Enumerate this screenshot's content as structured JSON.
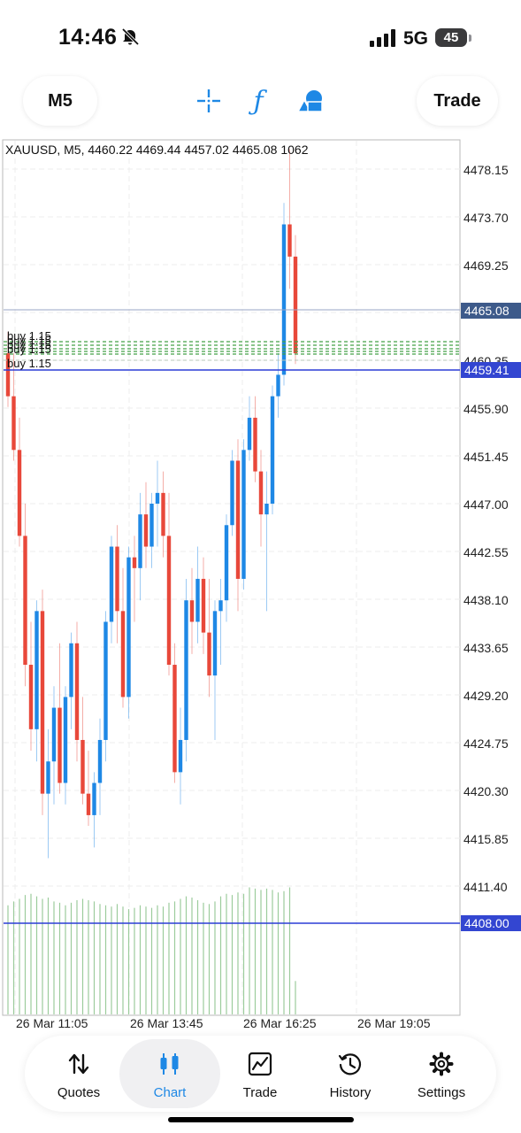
{
  "status_bar": {
    "time": "14:46",
    "network": "5G",
    "battery": "45"
  },
  "toolbar": {
    "timeframe": "M5",
    "trade_label": "Trade"
  },
  "chart": {
    "info": "XAUUSD, M5, 4460.22 4469.44 4457.02 4465.08 1062",
    "price_ticks": [
      "4478.15",
      "4473.70",
      "4469.25",
      "4460.35",
      "4455.90",
      "4451.45",
      "4447.00",
      "4442.55",
      "4438.10",
      "4433.65",
      "4429.20",
      "4424.75",
      "4420.30",
      "4415.85",
      "4411.40"
    ],
    "current_price": "4465.08",
    "order_line_price": "4459.41",
    "volume_line_price": "4408.00",
    "order_labels": [
      "buy 1.15",
      "buy 1.15",
      "buy 1.15",
      "buy 1.15",
      "buy 1.15"
    ],
    "time_labels": [
      "26 Mar 11:05",
      "26 Mar 13:45",
      "26 Mar 16:25",
      "26 Mar 19:05"
    ],
    "colors": {
      "bull": "#1e88e5",
      "bear": "#e8483a",
      "volume": "#9ccc9c",
      "order": "#43a047",
      "price_line": "#4a5fbd",
      "bid_line": "#2b3dd6"
    },
    "candles": [
      [
        4461,
        4463,
        4456,
        4457
      ],
      [
        4457,
        4461,
        4451,
        4452
      ],
      [
        4452,
        4455,
        4443,
        4444
      ],
      [
        4444,
        4447,
        4430,
        4432
      ],
      [
        4432,
        4436,
        4424,
        4426
      ],
      [
        4426,
        4438,
        4423,
        4437
      ],
      [
        4437,
        4439,
        4418,
        4420
      ],
      [
        4420,
        4426,
        4414,
        4423
      ],
      [
        4423,
        4430,
        4419,
        4428
      ],
      [
        4428,
        4434,
        4420,
        4421
      ],
      [
        4421,
        4430,
        4419,
        4429
      ],
      [
        4429,
        4435,
        4426,
        4434
      ],
      [
        4434,
        4436,
        4423,
        4425
      ],
      [
        4425,
        4429,
        4419,
        4420
      ],
      [
        4420,
        4424,
        4417,
        4418
      ],
      [
        4418,
        4422,
        4415,
        4421
      ],
      [
        4421,
        4427,
        4418,
        4425
      ],
      [
        4425,
        4437,
        4423,
        4436
      ],
      [
        4436,
        4444,
        4434,
        4443
      ],
      [
        4443,
        4445,
        4434,
        4437
      ],
      [
        4437,
        4441,
        4428,
        4429
      ],
      [
        4429,
        4443,
        4427,
        4442
      ],
      [
        4442,
        4444,
        4436,
        4441
      ],
      [
        4441,
        4448,
        4438,
        4446
      ],
      [
        4446,
        4449,
        4441,
        4443
      ],
      [
        4443,
        4448,
        4441,
        4447
      ],
      [
        4447,
        4451,
        4443,
        4448
      ],
      [
        4448,
        4450,
        4442,
        4444
      ],
      [
        4444,
        4448,
        4431,
        4432
      ],
      [
        4432,
        4434,
        4421,
        4422
      ],
      [
        4422,
        4428,
        4419,
        4425
      ],
      [
        4425,
        4440,
        4423,
        4438
      ],
      [
        4438,
        4441,
        4433,
        4436
      ],
      [
        4436,
        4443,
        4434,
        4440
      ],
      [
        4440,
        4442,
        4433,
        4435
      ],
      [
        4435,
        4440,
        4429,
        4431
      ],
      [
        4431,
        4438,
        4425,
        4437
      ],
      [
        4437,
        4440,
        4432,
        4438
      ],
      [
        4438,
        4446,
        4436,
        4445
      ],
      [
        4445,
        4452,
        4444,
        4451
      ],
      [
        4451,
        4453,
        4437,
        4440
      ],
      [
        4440,
        4453,
        4439,
        4452
      ],
      [
        4452,
        4457,
        4451,
        4455
      ],
      [
        4455,
        4457,
        4449,
        4450
      ],
      [
        4450,
        4452,
        4443,
        4446
      ],
      [
        4446,
        4450,
        4437,
        4447
      ],
      [
        4447,
        4458,
        4446,
        4457
      ],
      [
        4457,
        4461,
        4455,
        4459
      ],
      [
        4459,
        4475,
        4458,
        4473
      ],
      [
        4473,
        4480,
        4467,
        4470
      ],
      [
        4470,
        4472,
        4460,
        4461
      ]
    ],
    "volumes": [
      0.85,
      0.88,
      0.9,
      0.93,
      0.94,
      0.92,
      0.9,
      0.91,
      0.88,
      0.87,
      0.85,
      0.87,
      0.89,
      0.9,
      0.89,
      0.88,
      0.86,
      0.85,
      0.84,
      0.86,
      0.84,
      0.82,
      0.83,
      0.85,
      0.84,
      0.83,
      0.85,
      0.84,
      0.87,
      0.88,
      0.9,
      0.92,
      0.91,
      0.89,
      0.87,
      0.86,
      0.88,
      0.92,
      0.94,
      0.93,
      0.95,
      0.94,
      0.99,
      0.98,
      0.97,
      0.98,
      0.97,
      0.95,
      0.96,
      0.99,
      0.26
    ]
  },
  "nav": {
    "items": [
      {
        "label": "Quotes",
        "icon": "quotes-icon"
      },
      {
        "label": "Chart",
        "icon": "chart-icon"
      },
      {
        "label": "Trade",
        "icon": "trade-icon"
      },
      {
        "label": "History",
        "icon": "history-icon"
      },
      {
        "label": "Settings",
        "icon": "settings-icon"
      }
    ]
  }
}
